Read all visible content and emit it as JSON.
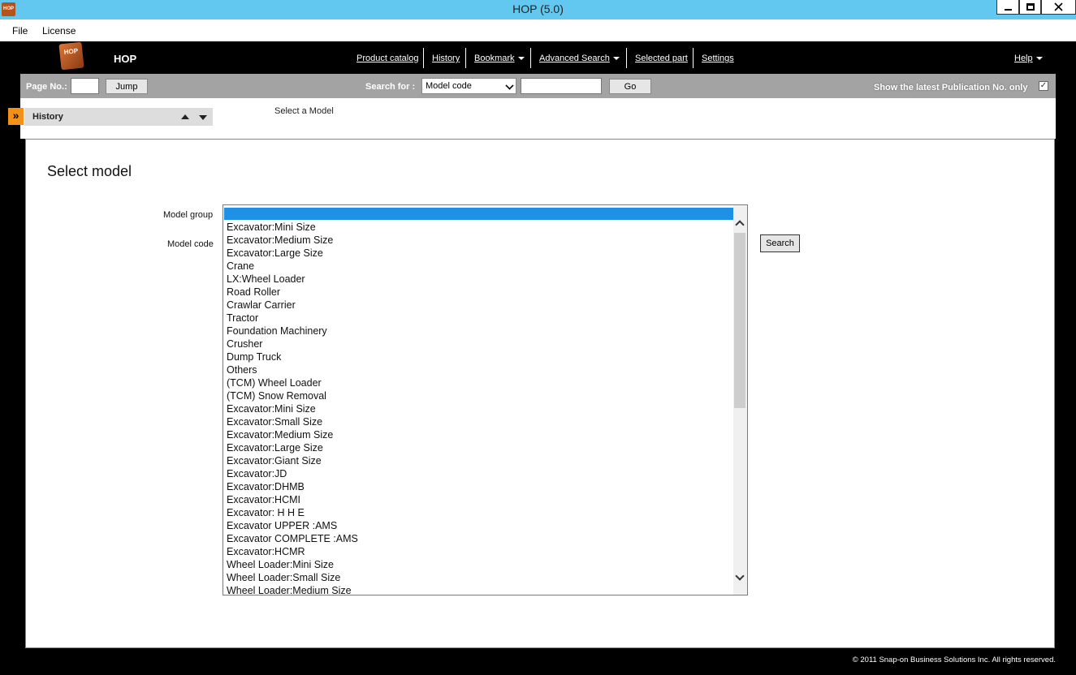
{
  "window": {
    "title": "HOP (5.0)",
    "icon_text": "HOP"
  },
  "menu": {
    "file": "File",
    "license": "License"
  },
  "header": {
    "logo_text": "HOP",
    "app_name": "HOP",
    "nav": {
      "product_catalog": "Product catalog",
      "history": "History",
      "bookmark": "Bookmark",
      "advanced_search": "Advanced Search",
      "selected_part": "Selected part",
      "settings": "Settings",
      "help": "Help"
    }
  },
  "toolbar": {
    "page_label": "Page No.:",
    "page_value": "",
    "jump_label": "Jump",
    "search_for_label": "Search for :",
    "search_type_value": "Model code",
    "search_value": "",
    "go_label": "Go",
    "show_latest_label": "Show the latest Publication No. only",
    "show_latest_checked": true
  },
  "history_panel": {
    "label": "History",
    "expand_glyph": "»"
  },
  "breadcrumb": "Select a Model",
  "main": {
    "title": "Select model",
    "model_group_label": "Model group",
    "model_code_label": "Model code",
    "search_label": "Search"
  },
  "model_groups": [
    "Excavator:Mini Size",
    "Excavator:Medium Size",
    "Excavator:Large Size",
    "Crane",
    "LX:Wheel Loader",
    "Road Roller",
    "Crawlar Carrier",
    "Tractor",
    "Foundation Machinery",
    "Crusher",
    "Dump Truck",
    "Others",
    "(TCM) Wheel Loader",
    "(TCM) Snow Removal",
    "Excavator:Mini Size",
    "Excavator:Small Size",
    "Excavator:Medium Size",
    "Excavator:Large Size",
    "Excavator:Giant Size",
    "Excavator:JD",
    "Excavator:DHMB",
    "Excavator:HCMI",
    "Excavator: H H E",
    "Excavator UPPER :AMS",
    "Excavator COMPLETE :AMS",
    "Excavator:HCMR",
    "Wheel Loader:Mini Size",
    "Wheel Loader:Small Size",
    "Wheel Loader:Medium Size"
  ],
  "footer": "© 2011 Snap-on Business Solutions Inc. All rights reserved."
}
